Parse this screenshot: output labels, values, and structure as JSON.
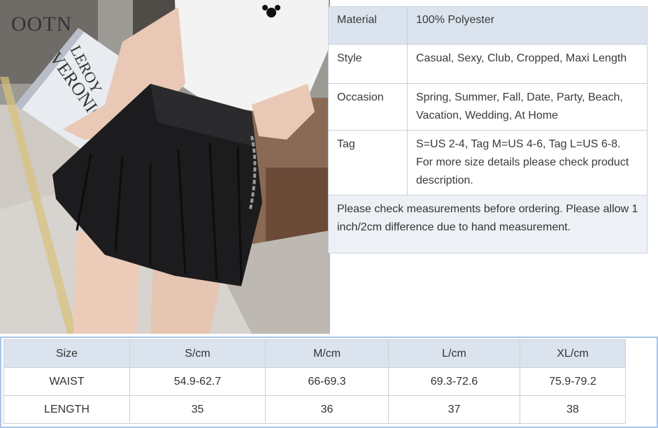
{
  "photo": {
    "brand": "OOTN",
    "magazine_lines": [
      "VERONIQUE",
      "LEROY"
    ]
  },
  "attributes": [
    {
      "label": "Material",
      "value": "100% Polyester"
    },
    {
      "label": "Style",
      "value": "Casual, Sexy, Club, Cropped, Maxi Length"
    },
    {
      "label": "Occasion",
      "value": "Spring, Summer, Fall, Date, Party, Beach, Vacation, Wedding, At Home"
    },
    {
      "label": "Tag",
      "value": "S=US 2-4, Tag M=US 4-6, Tag L=US 6-8. For more size details please check product description."
    }
  ],
  "note": "Please check measurements before ordering. Please allow 1 inch/2cm difference due to hand measurement.",
  "size_table": {
    "headers": [
      "Size",
      "S/cm",
      "M/cm",
      "L/cm",
      "XL/cm"
    ],
    "rows": [
      [
        "WAIST",
        "54.9-62.7",
        "66-69.3",
        "69.3-72.6",
        "75.9-79.2"
      ],
      [
        "LENGTH",
        "35",
        "36",
        "37",
        "38"
      ]
    ]
  },
  "colors": {
    "header_bg": "#dbe3ee",
    "note_bg": "#edf1f6",
    "border": "#c9d1da",
    "size_frame": "#a9c4e6",
    "skirt": "#1c1c1e"
  }
}
